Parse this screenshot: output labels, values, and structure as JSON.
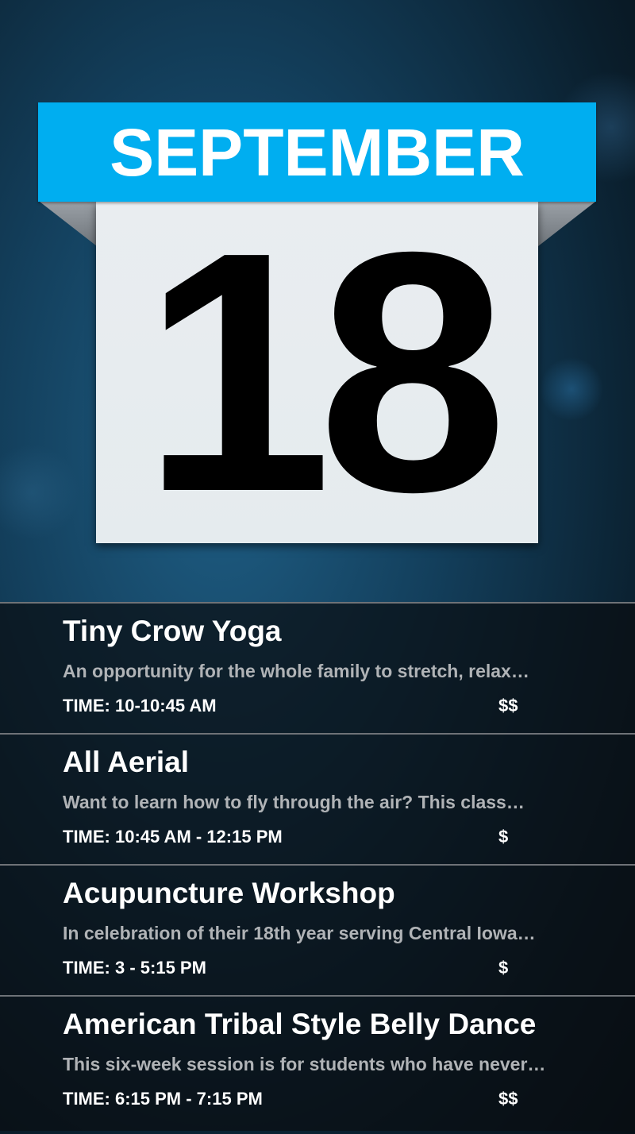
{
  "calendar": {
    "month": "SEPTEMBER",
    "day": "18",
    "accent_color": "#00aef0"
  },
  "events": [
    {
      "title": "Tiny Crow Yoga",
      "description": "An opportunity for the whole family to stretch, relax…",
      "time": "TIME: 10-10:45 AM",
      "price": "$$"
    },
    {
      "title": "All Aerial",
      "description": "Want to learn how to fly through the air? This class…",
      "time": "TIME: 10:45 AM - 12:15 PM",
      "price": "$"
    },
    {
      "title": "Acupuncture Workshop",
      "description": "In celebration of their 18th year serving Central Iowa…",
      "time": "TIME: 3 - 5:15 PM",
      "price": "$"
    },
    {
      "title": "American Tribal Style Belly Dance",
      "description": "This six-week session is for students who have never…",
      "time": "TIME: 6:15 PM - 7:15 PM",
      "price": "$$"
    }
  ]
}
